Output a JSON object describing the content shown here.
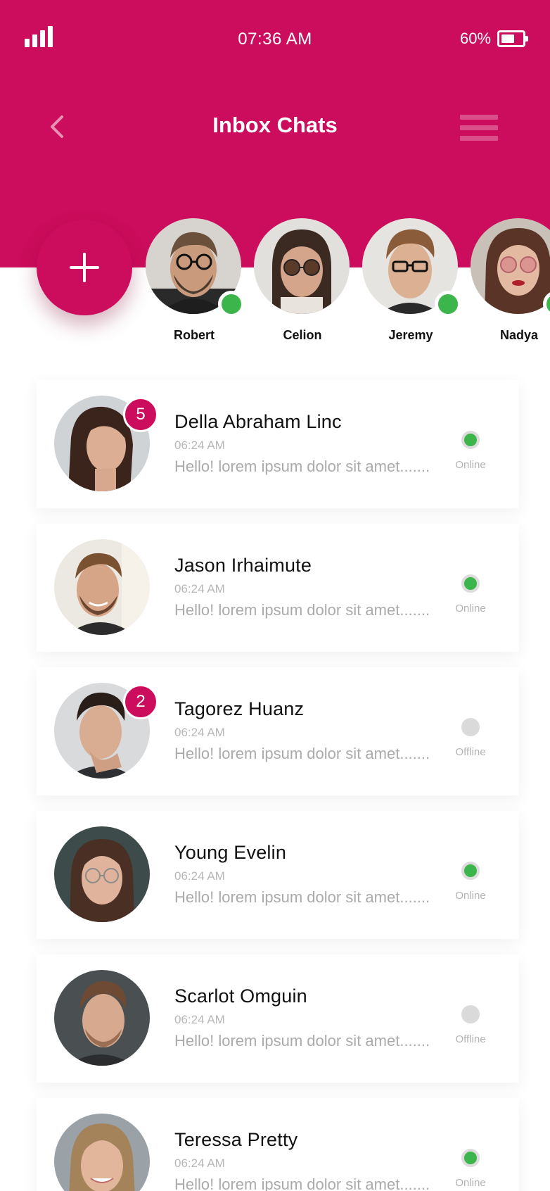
{
  "status_bar": {
    "time": "07:36 AM",
    "battery": "60%"
  },
  "header": {
    "title": "Inbox Chats"
  },
  "stories": [
    {
      "name": "Robert",
      "online": true
    },
    {
      "name": "Celion",
      "online": false
    },
    {
      "name": "Jeremy",
      "online": true
    },
    {
      "name": "Nadya",
      "online": true
    }
  ],
  "chats": [
    {
      "name": "Della Abraham Linc",
      "time": "06:24 AM",
      "preview": "Hello! lorem ipsum dolor sit amet.......",
      "status": "Online",
      "unread": "5"
    },
    {
      "name": "Jason Irhaimute",
      "time": "06:24 AM",
      "preview": "Hello! lorem ipsum dolor sit amet.......",
      "status": "Online",
      "unread": ""
    },
    {
      "name": "Tagorez Huanz",
      "time": "06:24 AM",
      "preview": "Hello! lorem ipsum dolor sit amet.......",
      "status": "Offline",
      "unread": "2"
    },
    {
      "name": "Young Evelin",
      "time": "06:24 AM",
      "preview": "Hello! lorem ipsum dolor sit amet.......",
      "status": "Online",
      "unread": ""
    },
    {
      "name": "Scarlot Omguin",
      "time": "06:24 AM",
      "preview": "Hello! lorem ipsum dolor sit amet.......",
      "status": "Offline",
      "unread": ""
    },
    {
      "name": "Teressa Pretty",
      "time": "06:24 AM",
      "preview": "Hello! lorem ipsum dolor sit amet.......",
      "status": "Online",
      "unread": ""
    }
  ],
  "colors": {
    "brand": "#cc0c5c",
    "online": "#3cb54a",
    "offline": "#dadada"
  }
}
